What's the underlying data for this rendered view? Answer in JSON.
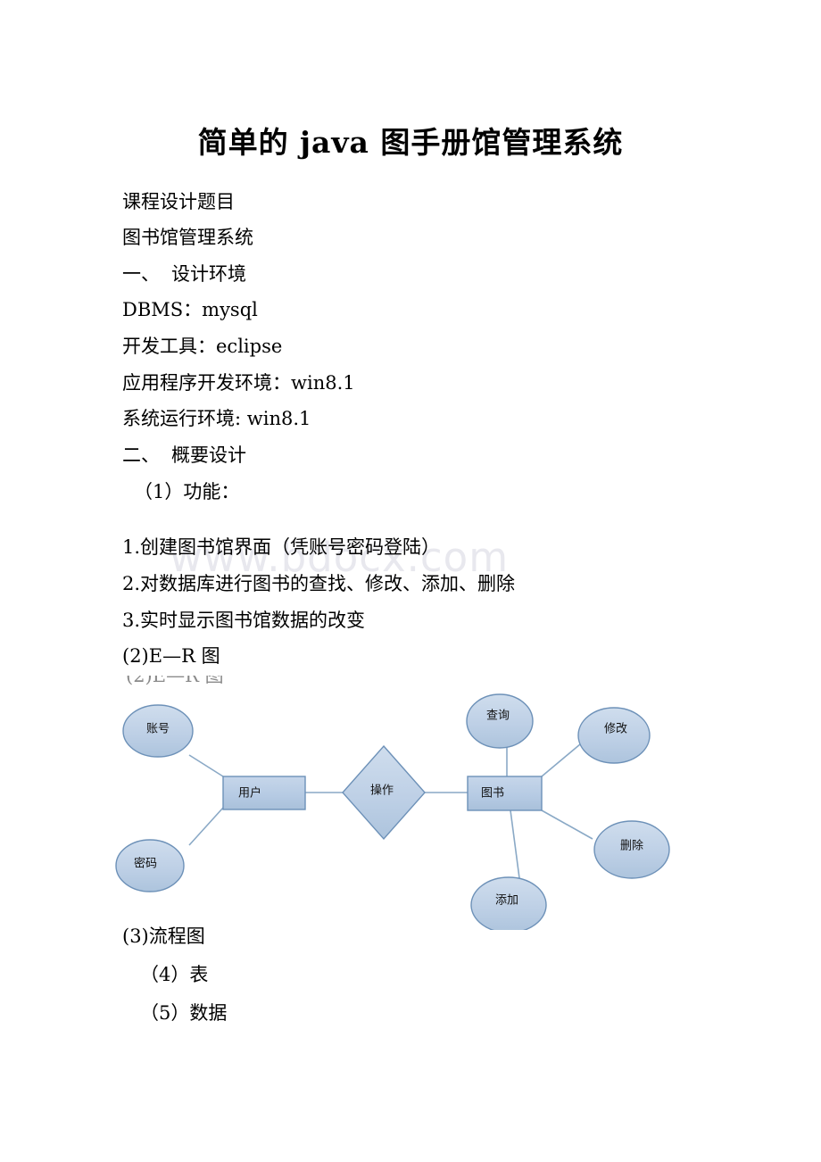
{
  "document": {
    "title": "简单的 java 图手册馆管理系统",
    "watermark": "www.bdocx.com",
    "lines": {
      "l1": "课程设计题目",
      "l2": "图书馆管理系统",
      "l3_num": "一、",
      "l3_text": "设计环境",
      "l4": "DBMS：mysql",
      "l5": "开发工具：eclipse",
      "l6": "应用程序开发环境：win8.1",
      "l7": "系统运行环境: win8.1",
      "l8_num": "二、",
      "l8_text": "概要设计",
      "l9": "（1）功能：",
      "l10": "1.创建图书馆界面（凭账号密码登陆）",
      "l11": "2.对数据库进行图书的查找、修改、添加、删除",
      "l12": "3.实时显示图书馆数据的改变",
      "l13": "(2)E—R 图",
      "l13_ghost": "(2)E—R 图",
      "l14": "(3)流程图",
      "l15": "（4）表",
      "l16": "（5）数据"
    }
  },
  "er_diagram": {
    "caption": "E—R 图",
    "colors": {
      "fill_light": "#c3d4e8",
      "fill_mid": "#b3c9e2",
      "stroke": "#6d91b8",
      "line": "#8aa9c6",
      "text": "#111111"
    },
    "entities": [
      {
        "id": "user",
        "label": "用户",
        "shape": "rectangle"
      },
      {
        "id": "book",
        "label": "图书",
        "shape": "rectangle"
      }
    ],
    "relationships": [
      {
        "id": "operate",
        "label": "操作",
        "shape": "diamond"
      }
    ],
    "attributes": [
      {
        "id": "account",
        "label": "账号",
        "shape": "ellipse",
        "owner": "user"
      },
      {
        "id": "password",
        "label": "密码",
        "shape": "ellipse",
        "owner": "user"
      },
      {
        "id": "query",
        "label": "查询",
        "shape": "ellipse",
        "owner": "book"
      },
      {
        "id": "modify",
        "label": "修改",
        "shape": "ellipse",
        "owner": "book"
      },
      {
        "id": "delete",
        "label": "删除",
        "shape": "ellipse",
        "owner": "book"
      },
      {
        "id": "add",
        "label": "添加",
        "shape": "ellipse",
        "owner": "book"
      }
    ],
    "connections": [
      {
        "from": "account",
        "to": "user"
      },
      {
        "from": "password",
        "to": "user"
      },
      {
        "from": "user",
        "to": "operate"
      },
      {
        "from": "operate",
        "to": "book"
      },
      {
        "from": "query",
        "to": "book"
      },
      {
        "from": "modify",
        "to": "book"
      },
      {
        "from": "delete",
        "to": "book"
      },
      {
        "from": "add",
        "to": "book"
      }
    ]
  }
}
